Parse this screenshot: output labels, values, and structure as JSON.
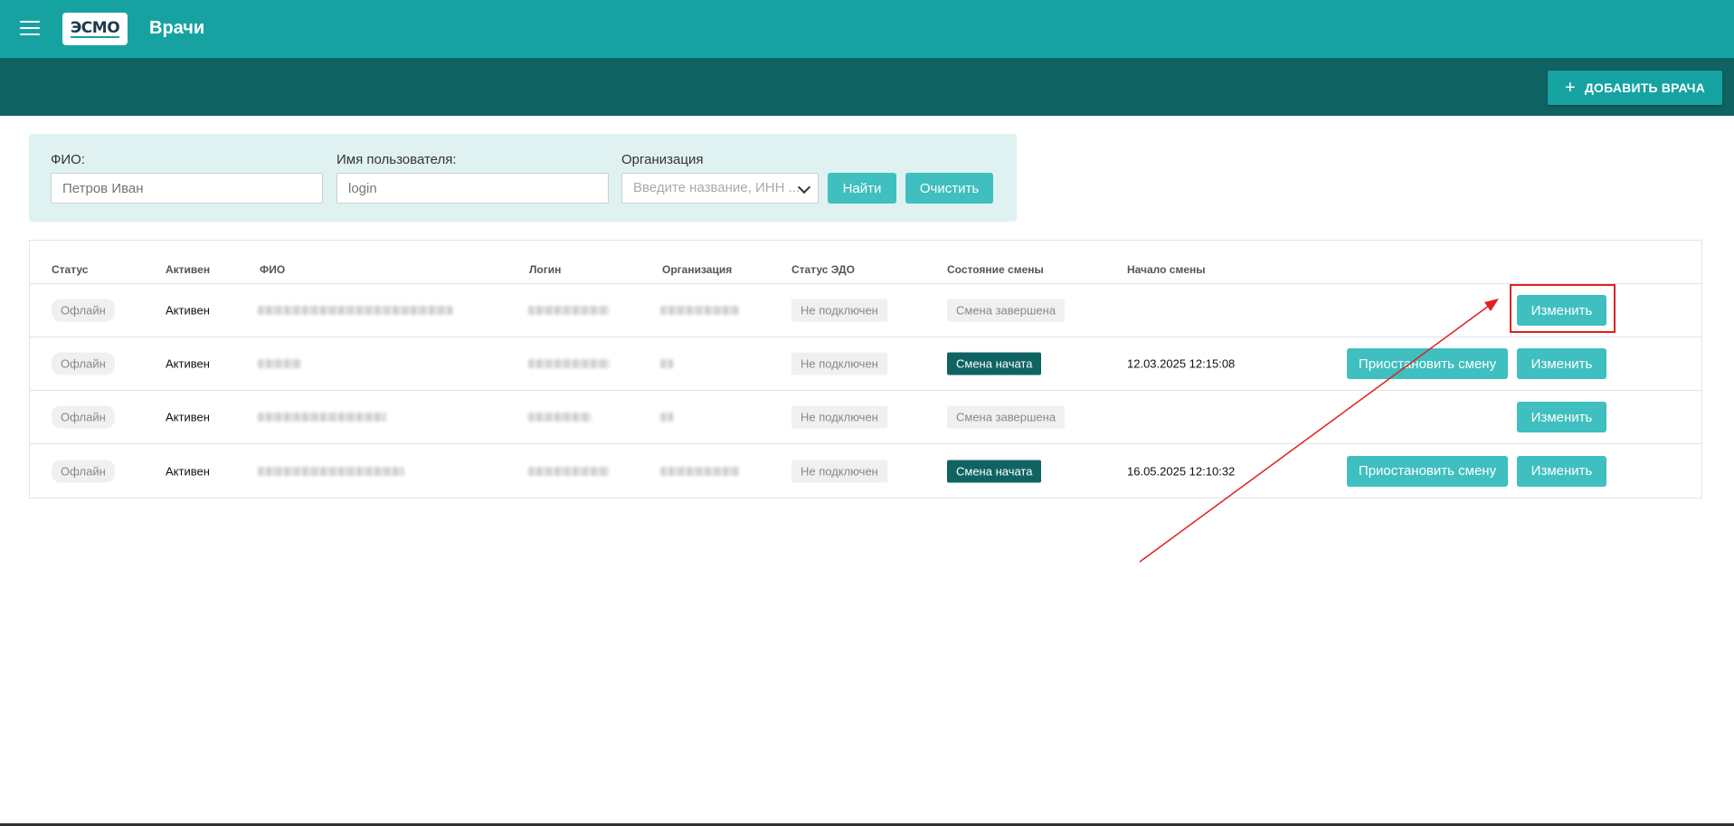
{
  "header": {
    "logo_text": "ЭСМО",
    "title": "Врачи",
    "add_button": "ДОБАВИТЬ ВРАЧА",
    "add_icon": "+"
  },
  "filters": {
    "fio_label": "ФИО:",
    "fio_placeholder": "Петров Иван",
    "username_label": "Имя пользователя:",
    "username_placeholder": "login",
    "org_label": "Организация",
    "org_placeholder": "Введите название, ИНН ...",
    "search_button": "Найти",
    "clear_button": "Очистить"
  },
  "table": {
    "headers": [
      "Статус",
      "Активен",
      "ФИО",
      "Логин",
      "Организация",
      "Статус ЭДО",
      "Состояние смены",
      "Начало смены"
    ],
    "rows": [
      {
        "status": "Офлайн",
        "active": "Активен",
        "edo": "Не подключен",
        "shift": "Смена завершена",
        "shift_active": false,
        "start": "",
        "pause": "",
        "edit": "Изменить"
      },
      {
        "status": "Офлайн",
        "active": "Активен",
        "edo": "Не подключен",
        "shift": "Смена начата",
        "shift_active": true,
        "start": "12.03.2025 12:15:08",
        "pause": "Приостановить смену",
        "edit": "Изменить"
      },
      {
        "status": "Офлайн",
        "active": "Активен",
        "edo": "Не подключен",
        "shift": "Смена завершена",
        "shift_active": false,
        "start": "",
        "pause": "",
        "edit": "Изменить"
      },
      {
        "status": "Офлайн",
        "active": "Активен",
        "edo": "Не подключен",
        "shift": "Смена начата",
        "shift_active": true,
        "start": "16.05.2025 12:10:32",
        "pause": "Приостановить смену",
        "edit": "Изменить"
      }
    ]
  },
  "colors": {
    "primary": "#17a2a2",
    "dark": "#0f6363",
    "button": "#3fbfbf",
    "annotation": "#e02020"
  }
}
